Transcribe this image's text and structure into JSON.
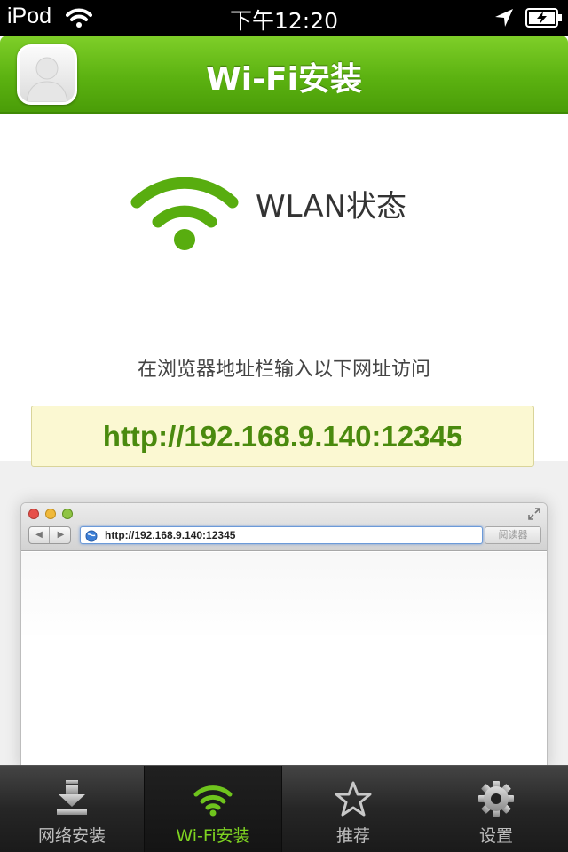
{
  "status_bar": {
    "carrier": "iPod",
    "time": "下午12:20"
  },
  "nav": {
    "title": "Wi-Fi安装"
  },
  "main": {
    "wlan_status": "WLAN状态",
    "instruction": "在浏览器地址栏输入以下网址访问",
    "url": "http://192.168.9.140:12345"
  },
  "browser": {
    "address": "http://192.168.9.140:12345",
    "reader_label": "阅读器"
  },
  "tabs": [
    {
      "label": "网络安装",
      "icon": "download-icon",
      "selected": false
    },
    {
      "label": "Wi-Fi安装",
      "icon": "wifi-icon",
      "selected": true
    },
    {
      "label": "推荐",
      "icon": "star-icon",
      "selected": false
    },
    {
      "label": "设置",
      "icon": "gear-icon",
      "selected": false
    }
  ],
  "colors": {
    "accent": "#5cb211",
    "tab_active": "#7ed321",
    "url_text": "#4a8a0e",
    "url_box_bg": "#fbf8d2"
  }
}
